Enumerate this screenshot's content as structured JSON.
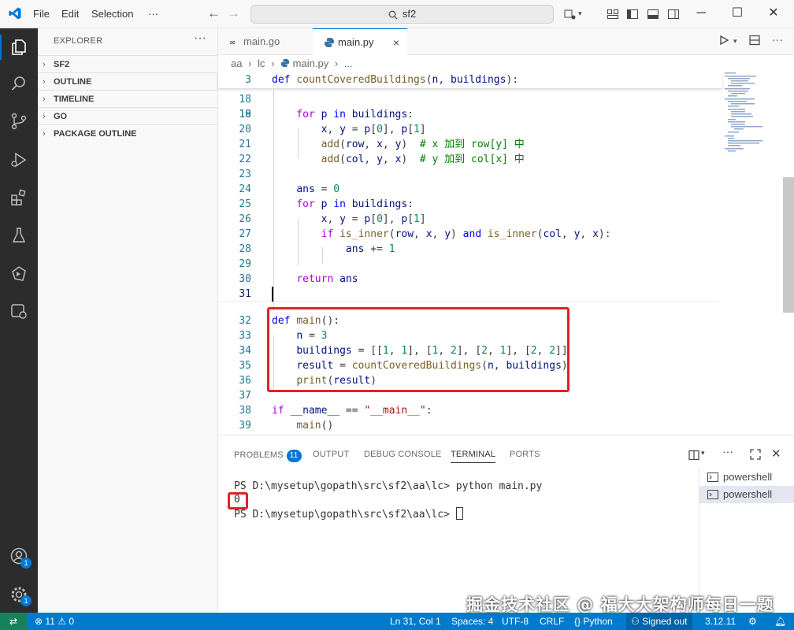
{
  "titlebar": {
    "menus": [
      "File",
      "Edit",
      "Selection"
    ],
    "more": "···",
    "search": "sf2"
  },
  "sidebar": {
    "title": "EXPLORER",
    "more": "···",
    "sections": [
      "SF2",
      "OUTLINE",
      "TIMELINE",
      "GO",
      "PACKAGE OUTLINE"
    ]
  },
  "activity_badges": {
    "accounts": "1",
    "settings": "1"
  },
  "tabs": [
    {
      "label": "main.go",
      "icon": "go-file-icon"
    },
    {
      "label": "main.py",
      "icon": "python-file-icon",
      "close": "×"
    }
  ],
  "breadcrumb": [
    "aa",
    "lc",
    "main.py",
    "..."
  ],
  "editor": {
    "lines": [
      {
        "n": "3",
        "html": "def countCoveredBuildings"
      },
      {
        "n": "18"
      },
      {
        "n": "19"
      },
      {
        "n": "20"
      },
      {
        "n": "21"
      },
      {
        "n": "22"
      },
      {
        "n": "23"
      },
      {
        "n": "24"
      },
      {
        "n": "25"
      },
      {
        "n": "26"
      },
      {
        "n": "27"
      },
      {
        "n": "28"
      },
      {
        "n": "29"
      },
      {
        "n": "30"
      },
      {
        "n": "31"
      },
      {
        "n": "32"
      },
      {
        "n": "33"
      },
      {
        "n": "34"
      },
      {
        "n": "35"
      },
      {
        "n": "36"
      },
      {
        "n": "37"
      },
      {
        "n": "38"
      },
      {
        "n": "39"
      }
    ]
  },
  "panel": {
    "tabs": [
      "PROBLEMS",
      "OUTPUT",
      "DEBUG CONSOLE",
      "TERMINAL",
      "PORTS"
    ],
    "problems_count": "11",
    "terminal_lines": [
      "PS D:\\mysetup\\gopath\\src\\sf2\\aa\\lc> python main.py",
      "0",
      "PS D:\\mysetup\\gopath\\src\\sf2\\aa\\lc> "
    ],
    "terminals": [
      "powershell",
      "powershell"
    ]
  },
  "statusbar": {
    "errors": "11",
    "warnings": "0",
    "position": "Ln 31, Col 1",
    "spaces": "Spaces: 4",
    "encoding": "UTF-8",
    "eol": "CRLF",
    "language": "Python",
    "account": "Signed out",
    "version": "3.12.11"
  },
  "watermark": "掘金技术社区 @ 福大大架构师每日一题",
  "colors": {
    "accent": "#0078d4",
    "statusbar": "#007acc",
    "highlight": "#e02424"
  }
}
